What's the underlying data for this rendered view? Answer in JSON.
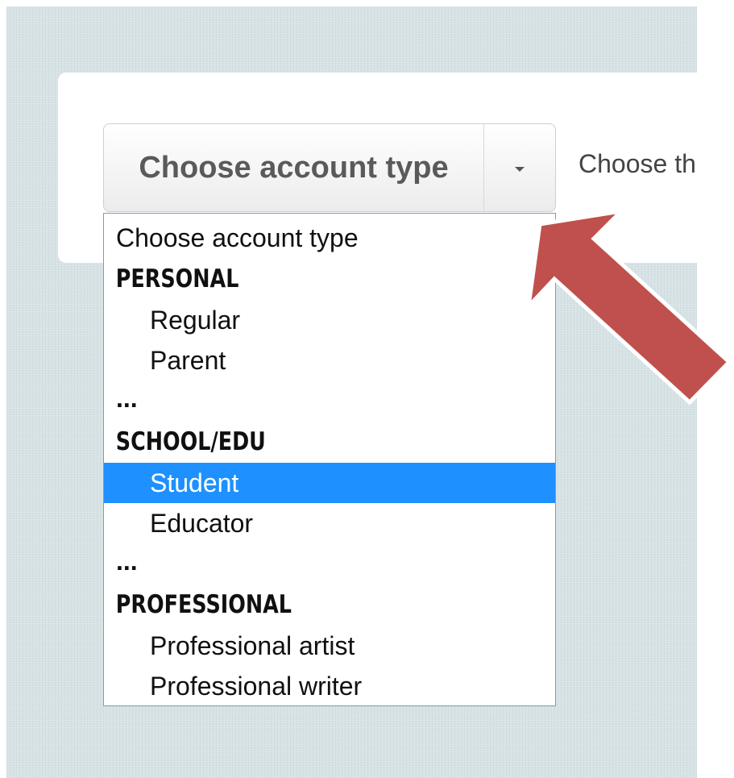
{
  "account_select": {
    "button_label": "Choose account type",
    "caret_icon": "caret-down-icon",
    "helper_text": "Choose th",
    "options": [
      {
        "label": "Choose account type",
        "kind": "placeholder"
      },
      {
        "label": "PERSONAL",
        "kind": "group"
      },
      {
        "label": "Regular",
        "kind": "child"
      },
      {
        "label": "Parent",
        "kind": "child"
      },
      {
        "label": "...",
        "kind": "ellipsis"
      },
      {
        "label": "SCHOOL/EDU",
        "kind": "group"
      },
      {
        "label": "Student",
        "kind": "child",
        "selected": true
      },
      {
        "label": "Educator",
        "kind": "child"
      },
      {
        "label": "...",
        "kind": "ellipsis"
      },
      {
        "label": "PROFESSIONAL",
        "kind": "group"
      },
      {
        "label": "Professional artist",
        "kind": "child"
      },
      {
        "label": "Professional writer",
        "kind": "child"
      }
    ]
  },
  "annotation": {
    "icon": "red-arrow-icon",
    "color": "#c0504d"
  },
  "colors": {
    "highlight": "#1e90ff",
    "background": "#d7e2e5",
    "listbox_border": "#7a9cc1"
  }
}
